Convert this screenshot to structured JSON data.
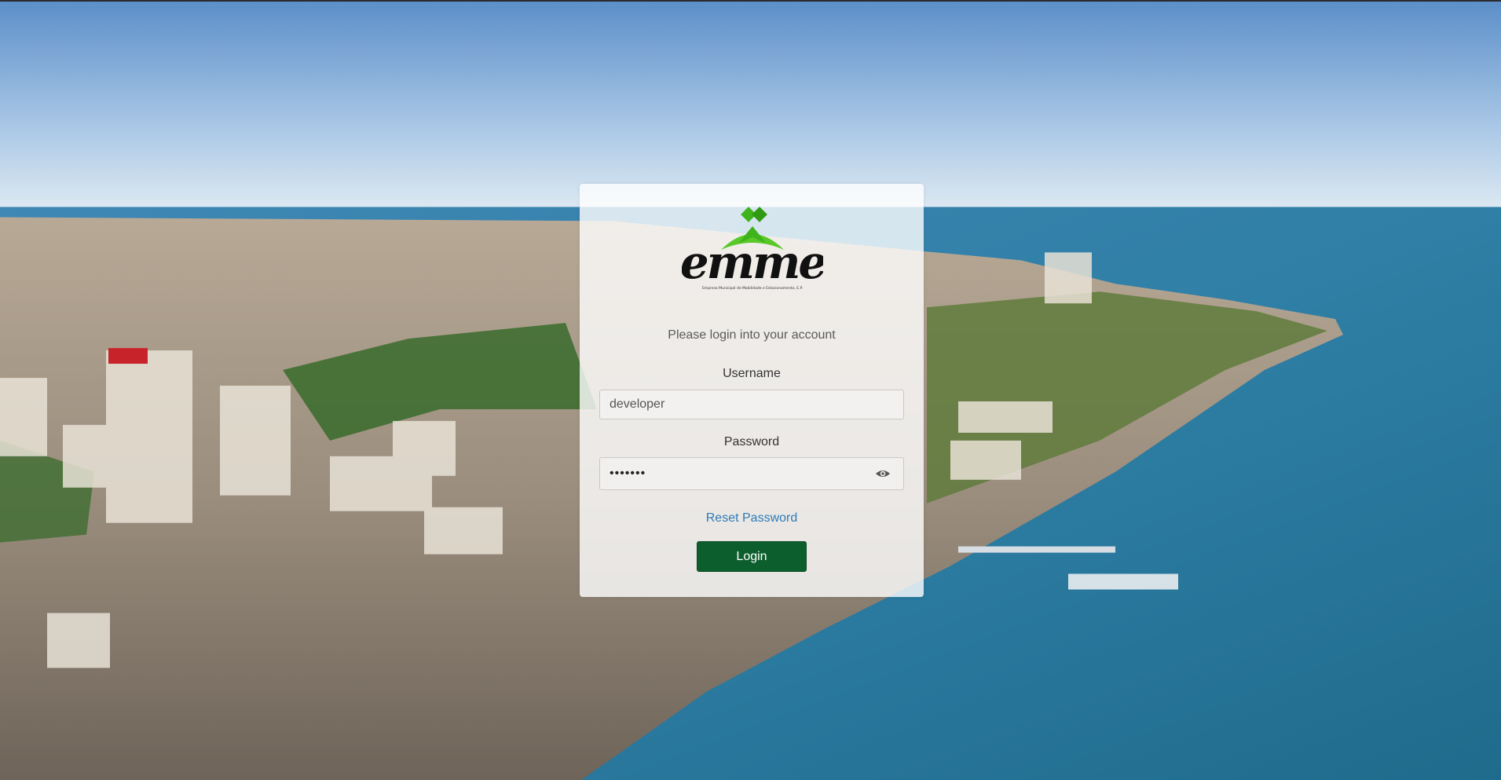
{
  "brand": {
    "logo_text": "emme",
    "tagline": "Empresa Municipal de Mobilidade e Estacionamento, E.P."
  },
  "login_form": {
    "subtitle": "Please login into your account",
    "username_label": "Username",
    "username_value": "developer",
    "password_label": "Password",
    "password_value": "•••••••",
    "reset_link": "Reset Password",
    "login_button": "Login",
    "show_password_icon": "eye-icon"
  },
  "colors": {
    "button_bg": "#0d5e2d",
    "link": "#2f7ab8",
    "logo_green": "#3fb31b"
  }
}
